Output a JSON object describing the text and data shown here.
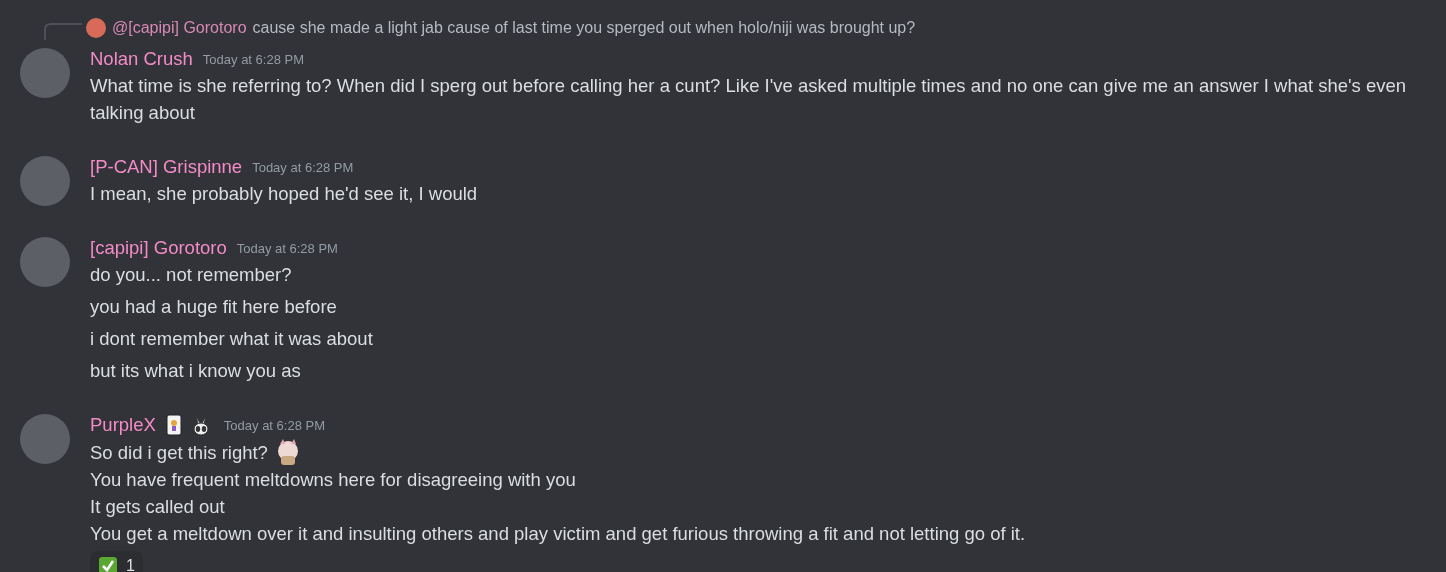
{
  "messages": [
    {
      "author": "Nolan Crush",
      "time": "Today at 6:28 PM",
      "kind": "multiline",
      "reply": {
        "author": "@[capipi] Gorotoro",
        "text": "cause she made a light jab cause of last time you sperged out when holo/niji was brought up?"
      },
      "lines": [
        {
          "text": "What time is she referring to? When did I sperg out before calling her a cunt? Like I've asked multiple times and no one can give me an answer I what she's even talking about"
        }
      ]
    },
    {
      "author": "[P-CAN] Grispinne",
      "time": "Today at 6:28 PM",
      "kind": "multiline",
      "lines": [
        {
          "text": "I mean, she probably hoped he'd see it, I would"
        }
      ]
    },
    {
      "author": "[capipi] Gorotoro",
      "time": "Today at 6:28 PM",
      "kind": "split",
      "lines": [
        {
          "text": "do you... not remember?"
        },
        {
          "text": "you had a huge fit here before"
        },
        {
          "text": "i dont remember what it was about"
        },
        {
          "text": "but its what i know you as"
        }
      ]
    },
    {
      "author": "PurpleX",
      "time": "Today at 6:28 PM",
      "kind": "multiline",
      "badges": [
        {
          "kind": "card"
        },
        {
          "kind": "rabbit"
        }
      ],
      "lines": [
        {
          "text": "So did i get this right?",
          "emoji": true
        },
        {
          "text": "You have frequent meltdowns here for disagreeing with you"
        },
        {
          "text": "It gets called out"
        },
        {
          "text": "You get a meltdown over it and insulting others and play victim and get furious throwing a fit and not letting go of it."
        }
      ],
      "reaction": {
        "count": "1"
      }
    }
  ]
}
